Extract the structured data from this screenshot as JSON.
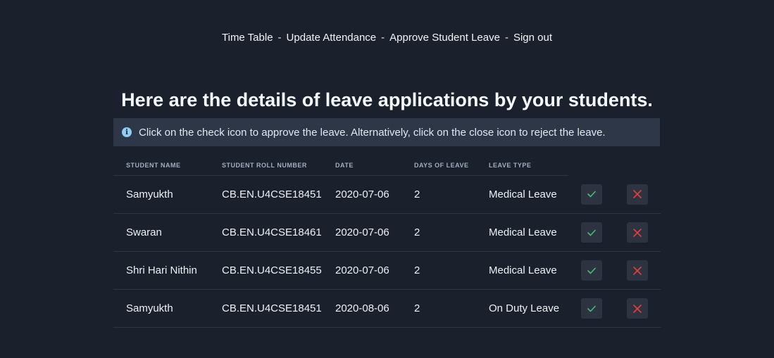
{
  "nav": {
    "items": [
      "Time Table",
      "Update Attendance",
      "Approve Student Leave",
      "Sign out"
    ],
    "separator": "-"
  },
  "heading": "Here are the details of leave applications by your students.",
  "info": {
    "icon": "info-circle-icon",
    "text": "Click on the check icon to approve the leave. Alternatively, click on the close icon to reject the leave."
  },
  "table": {
    "headers": [
      "Student Name",
      "Student Roll Number",
      "Date",
      "Days of Leave",
      "Leave Type"
    ],
    "rows": [
      [
        "Samyukth",
        "CB.EN.U4CSE18451",
        "2020-07-06",
        "2",
        "Medical Leave"
      ],
      [
        "Swaran",
        "CB.EN.U4CSE18461",
        "2020-07-06",
        "2",
        "Medical Leave"
      ],
      [
        "Shri Hari Nithin",
        "CB.EN.U4CSE18455",
        "2020-07-06",
        "2",
        "Medical Leave"
      ],
      [
        "Samyukth",
        "CB.EN.U4CSE18451",
        "2020-08-06",
        "2",
        "On Duty Leave"
      ]
    ],
    "approve_icon": "check-icon",
    "reject_icon": "close-icon"
  },
  "colors": {
    "background": "#1a202c",
    "info_bg": "#2d3748",
    "approve": "#48bb78",
    "reject": "#e53e3e"
  }
}
